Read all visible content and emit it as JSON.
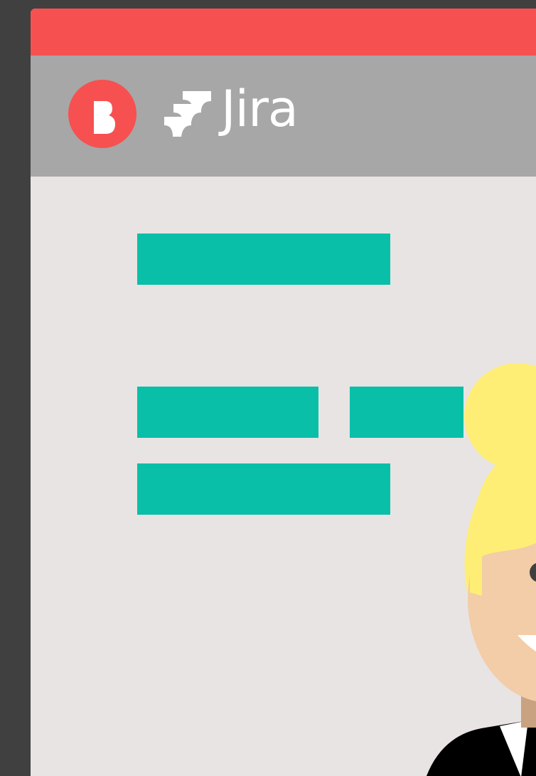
{
  "app": {
    "name": "Jira",
    "brand_badge_letter": "B",
    "brand_badge_icon": "b-logo-icon",
    "product_icon": "jira-logo-icon"
  },
  "colors": {
    "background": "#404040",
    "window": "#E8E4E3",
    "titlebar": "#F65150",
    "appbar": "#A7A7A7",
    "placeholder_bar": "#0ABFA8",
    "hair": "#FFEE75",
    "skin": "#F3CCA8",
    "eye": "#404040",
    "shirt": "#000000"
  },
  "content": {
    "placeholder_bars": [
      "",
      "",
      "",
      ""
    ]
  },
  "illustration": {
    "subject": "smiling-woman-with-blonde-bun"
  }
}
